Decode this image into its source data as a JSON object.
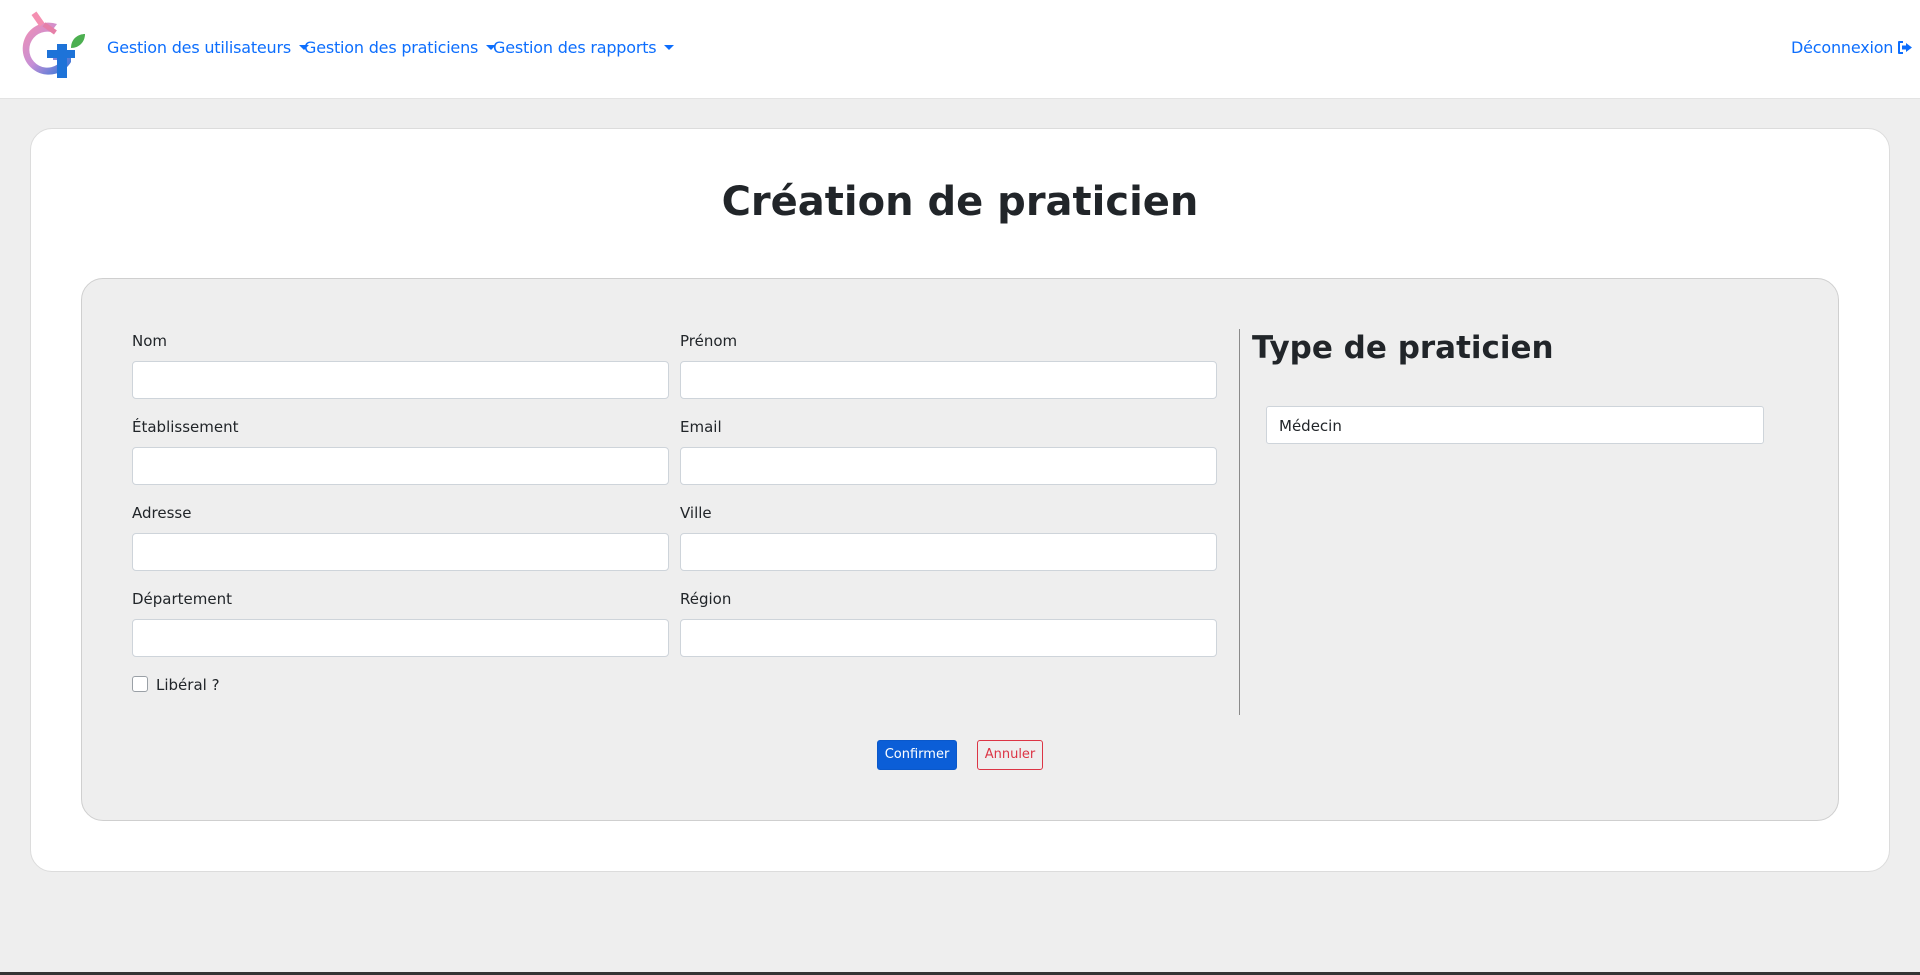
{
  "nav": {
    "items": [
      {
        "label": "Gestion des utilisateurs"
      },
      {
        "label": "Gestion des praticiens"
      },
      {
        "label": "Gestion des rapports"
      }
    ],
    "logout_label": "Déconnexion"
  },
  "page": {
    "title": "Création de praticien"
  },
  "form": {
    "fields": [
      {
        "label": "Nom",
        "value": ""
      },
      {
        "label": "Prénom",
        "value": ""
      },
      {
        "label": "Établissement",
        "value": ""
      },
      {
        "label": "Email",
        "value": ""
      },
      {
        "label": "Adresse",
        "value": ""
      },
      {
        "label": "Ville",
        "value": ""
      },
      {
        "label": "Département",
        "value": ""
      },
      {
        "label": "Région",
        "value": ""
      }
    ],
    "liberal_label": "Libéral ?",
    "liberal_checked": false,
    "confirm_label": "Confirmer",
    "cancel_label": "Annuler"
  },
  "type": {
    "title": "Type de praticien",
    "selected": "Médecin"
  },
  "colors": {
    "link": "#0d6efd",
    "primary": "#0b5ed7",
    "danger": "#dc3545",
    "background": "#eeeeee"
  }
}
